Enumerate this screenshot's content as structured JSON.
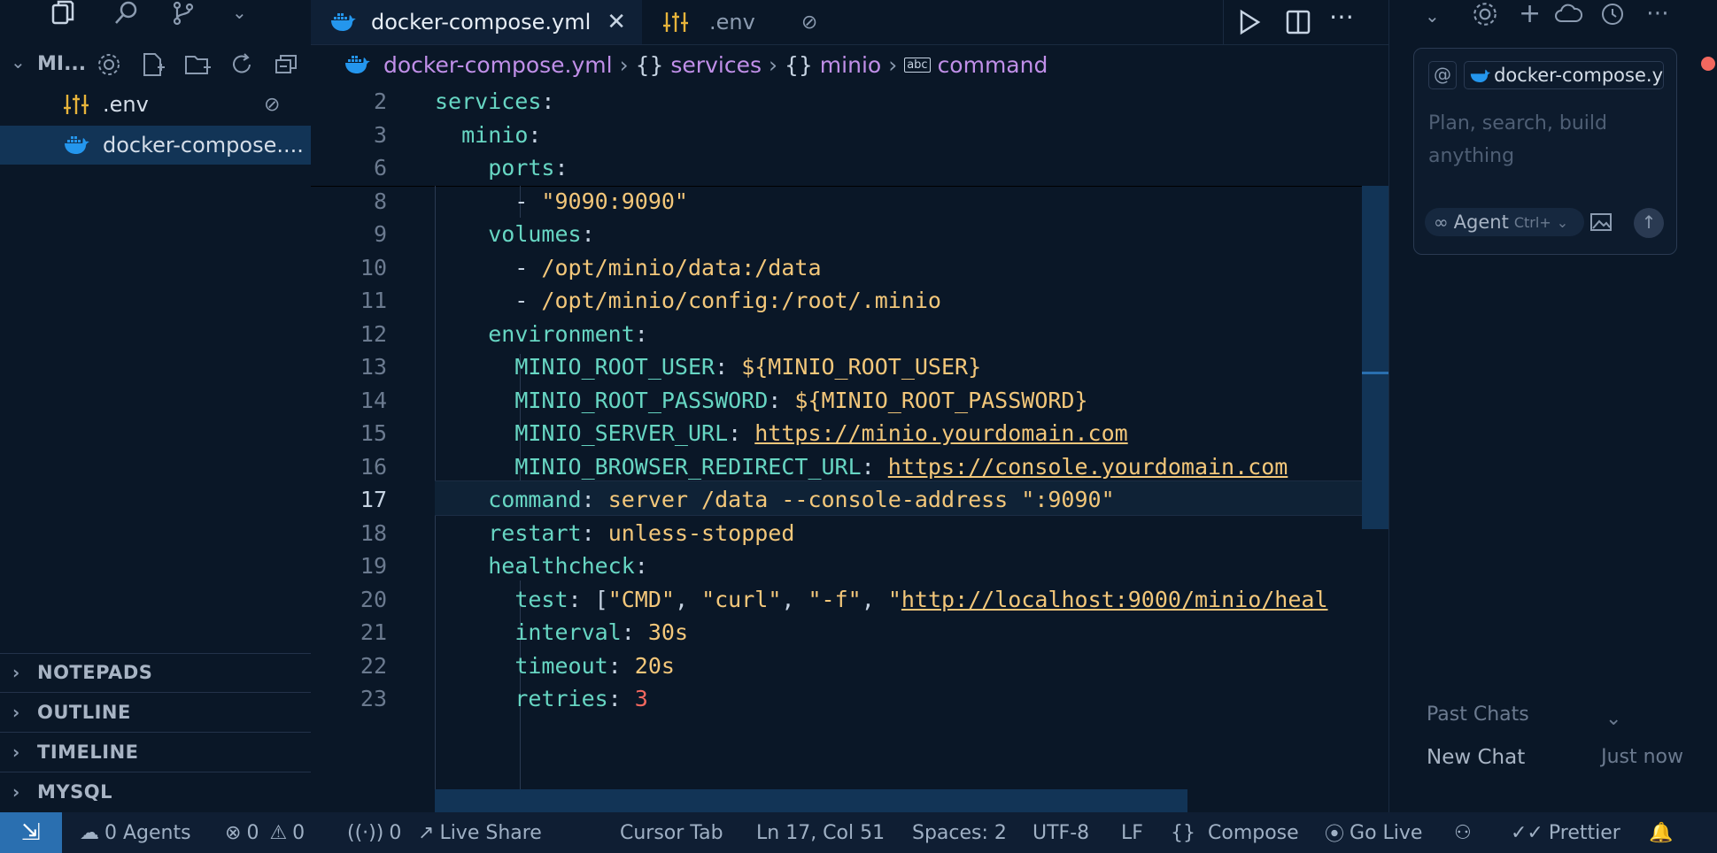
{
  "sidebar": {
    "explorer_title": "MI...",
    "files": [
      {
        "name": ".env",
        "icon": "settings-sliders-icon"
      },
      {
        "name": "docker-compose...."
      }
    ],
    "panels": [
      "NOTEPADS",
      "OUTLINE",
      "TIMELINE",
      "MYSQL"
    ]
  },
  "tabs": [
    {
      "label": "docker-compose.yml"
    },
    {
      "label": ".env"
    }
  ],
  "breadcrumb": {
    "file": "docker-compose.yml",
    "seg1_glyph": "{}",
    "seg1": "services",
    "seg2_glyph": "{}",
    "seg2": "minio",
    "seg3_glyph": "abc",
    "seg3": "command"
  },
  "code": {
    "lines": [
      {
        "n": "2",
        "parts": [
          [
            "k",
            "services"
          ],
          [
            "p",
            ":"
          ]
        ]
      },
      {
        "n": "3",
        "parts": [
          [
            "p",
            "  "
          ],
          [
            "k",
            "minio"
          ],
          [
            "p",
            ":"
          ]
        ]
      },
      {
        "n": "6",
        "parts": [
          [
            "p",
            "    "
          ],
          [
            "k",
            "ports"
          ],
          [
            "p",
            ":"
          ]
        ]
      },
      {
        "n": "8",
        "parts": [
          [
            "p",
            "      - "
          ],
          [
            "s",
            "\"9090:9090\""
          ]
        ]
      },
      {
        "n": "9",
        "parts": [
          [
            "p",
            "    "
          ],
          [
            "k",
            "volumes"
          ],
          [
            "p",
            ":"
          ]
        ]
      },
      {
        "n": "10",
        "parts": [
          [
            "p",
            "      - "
          ],
          [
            "s",
            "/opt/minio/data:/data"
          ]
        ]
      },
      {
        "n": "11",
        "parts": [
          [
            "p",
            "      - "
          ],
          [
            "s",
            "/opt/minio/config:/root/.minio"
          ]
        ]
      },
      {
        "n": "12",
        "parts": [
          [
            "p",
            "    "
          ],
          [
            "k",
            "environment"
          ],
          [
            "p",
            ":"
          ]
        ]
      },
      {
        "n": "13",
        "parts": [
          [
            "p",
            "      "
          ],
          [
            "k",
            "MINIO_ROOT_USER"
          ],
          [
            "p",
            ": "
          ],
          [
            "s",
            "${MINIO_ROOT_USER}"
          ]
        ]
      },
      {
        "n": "14",
        "parts": [
          [
            "p",
            "      "
          ],
          [
            "k",
            "MINIO_ROOT_PASSWORD"
          ],
          [
            "p",
            ": "
          ],
          [
            "s",
            "${MINIO_ROOT_PASSWORD}"
          ]
        ]
      },
      {
        "n": "15",
        "parts": [
          [
            "p",
            "      "
          ],
          [
            "k",
            "MINIO_SERVER_URL"
          ],
          [
            "p",
            ": "
          ],
          [
            "u",
            "https://minio.yourdomain.com"
          ]
        ]
      },
      {
        "n": "16",
        "parts": [
          [
            "p",
            "      "
          ],
          [
            "k",
            "MINIO_BROWSER_REDIRECT_URL"
          ],
          [
            "p",
            ": "
          ],
          [
            "u",
            "https://console.yourdomain.com"
          ]
        ]
      },
      {
        "n": "17",
        "parts": [
          [
            "p",
            "    "
          ],
          [
            "k",
            "command"
          ],
          [
            "p",
            ": "
          ],
          [
            "s",
            "server /data --console-address \":9090\""
          ]
        ]
      },
      {
        "n": "18",
        "parts": [
          [
            "p",
            "    "
          ],
          [
            "k",
            "restart"
          ],
          [
            "p",
            ": "
          ],
          [
            "s",
            "unless-stopped"
          ]
        ]
      },
      {
        "n": "19",
        "parts": [
          [
            "p",
            "    "
          ],
          [
            "k",
            "healthcheck"
          ],
          [
            "p",
            ":"
          ]
        ]
      },
      {
        "n": "20",
        "parts": [
          [
            "p",
            "      "
          ],
          [
            "k",
            "test"
          ],
          [
            "p",
            ": ["
          ],
          [
            "s",
            "\"CMD\""
          ],
          [
            "p",
            ", "
          ],
          [
            "s",
            "\"curl\""
          ],
          [
            "p",
            ", "
          ],
          [
            "s",
            "\"-f\""
          ],
          [
            "p",
            ", "
          ],
          [
            "s",
            "\""
          ],
          [
            "u",
            "http://localhost:9000/minio/heal"
          ]
        ]
      },
      {
        "n": "21",
        "parts": [
          [
            "p",
            "      "
          ],
          [
            "k",
            "interval"
          ],
          [
            "p",
            ": "
          ],
          [
            "s",
            "30s"
          ]
        ]
      },
      {
        "n": "22",
        "parts": [
          [
            "p",
            "      "
          ],
          [
            "k",
            "timeout"
          ],
          [
            "p",
            ": "
          ],
          [
            "s",
            "20s"
          ]
        ]
      },
      {
        "n": "23",
        "parts": [
          [
            "p",
            "      "
          ],
          [
            "k",
            "retries"
          ],
          [
            "p",
            ": "
          ],
          [
            "n",
            "3"
          ]
        ]
      }
    ],
    "current_line": "17"
  },
  "chat": {
    "context_chip": "docker-compose.y",
    "placeholder": "Plan, search, build anything",
    "mode": "Agent",
    "shortcut": "Ctrl+",
    "past_chats": "Past Chats",
    "chat_title": "New Chat",
    "chat_time": "Just now"
  },
  "status": {
    "agents": "0 Agents",
    "errors": "0",
    "warnings": "0",
    "ports": "0",
    "live_share": "Live Share",
    "cursor_tab": "Cursor Tab",
    "position": "Ln 17, Col 51",
    "spaces": "Spaces: 2",
    "encoding": "UTF-8",
    "eol": "LF",
    "language": "Compose",
    "go_live": "Go Live",
    "prettier": "Prettier"
  },
  "colors": {
    "background": "#0a1727",
    "key": "#67d6c3",
    "string": "#f3c77a",
    "number": "#f2685f",
    "breadcrumb": "#c08fe8",
    "docker": "#2496ed"
  }
}
